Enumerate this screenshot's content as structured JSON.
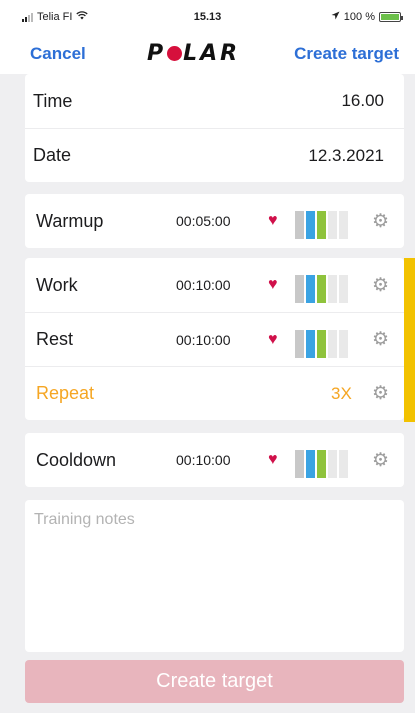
{
  "status_bar": {
    "carrier": "Telia FI",
    "time": "15.13",
    "battery": "100 %"
  },
  "nav": {
    "cancel_label": "Cancel",
    "logo_text": "POLAR",
    "create_label": "Create target"
  },
  "schedule": {
    "time_label": "Time",
    "time_value": "16.00",
    "date_label": "Date",
    "date_value": "12.3.2021"
  },
  "phases": {
    "warmup": {
      "label": "Warmup",
      "duration": "00:05:00"
    },
    "work": {
      "label": "Work",
      "duration": "00:10:00"
    },
    "rest": {
      "label": "Rest",
      "duration": "00:10:00"
    },
    "repeat": {
      "label": "Repeat",
      "value": "3X"
    },
    "cooldown": {
      "label": "Cooldown",
      "duration": "00:10:00"
    }
  },
  "heart_zone_colors": [
    "#c8c8c8",
    "#3aa3e3",
    "#8fc33c",
    "#e9e9e9",
    "#e9e9e9"
  ],
  "notes_placeholder": "Training notes",
  "create_button_label": "Create target",
  "colors": {
    "accent_blue": "#2d6fd6",
    "brand_red": "#d6103c",
    "heart_red": "#d0104a",
    "repeat_orange": "#f5a623",
    "repeat_bar": "#f2c200",
    "disabled_button": "#e8b5bd"
  },
  "icons": [
    "location-arrow-icon",
    "heart-icon",
    "gear-icon",
    "wifi-icon",
    "signal-icon",
    "battery-icon"
  ]
}
